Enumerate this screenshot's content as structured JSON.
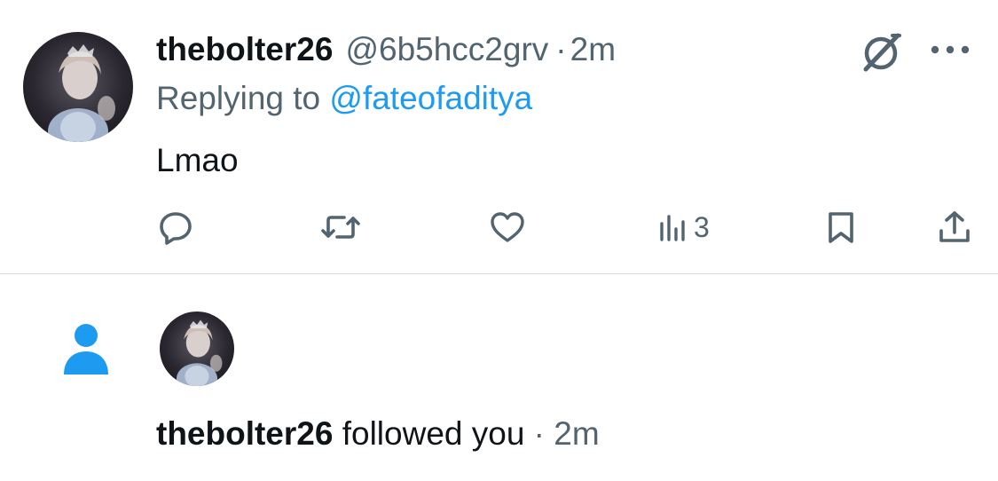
{
  "tweet": {
    "display_name": "thebolter26",
    "handle": "@6b5hcc2grv",
    "separator": "·",
    "time": "2m",
    "replying_prefix": "Replying to ",
    "replying_handle": "@fateofaditya",
    "text": "Lmao",
    "views_count": "3",
    "icons": {
      "grok": "grok-icon",
      "more": "more-icon",
      "reply": "reply-icon",
      "retweet": "retweet-icon",
      "like": "like-icon",
      "views": "views-icon",
      "bookmark": "bookmark-icon",
      "share": "share-icon"
    }
  },
  "notification": {
    "name": "thebolter26",
    "action": " followed you",
    "separator": " · ",
    "time": "2m",
    "icon": "person-icon"
  },
  "colors": {
    "text_primary": "#0f1419",
    "text_secondary": "#536471",
    "link": "#1d9bf0",
    "follow_icon": "#1d9bf0",
    "divider": "#d8dde2",
    "background": "#ffffff"
  }
}
